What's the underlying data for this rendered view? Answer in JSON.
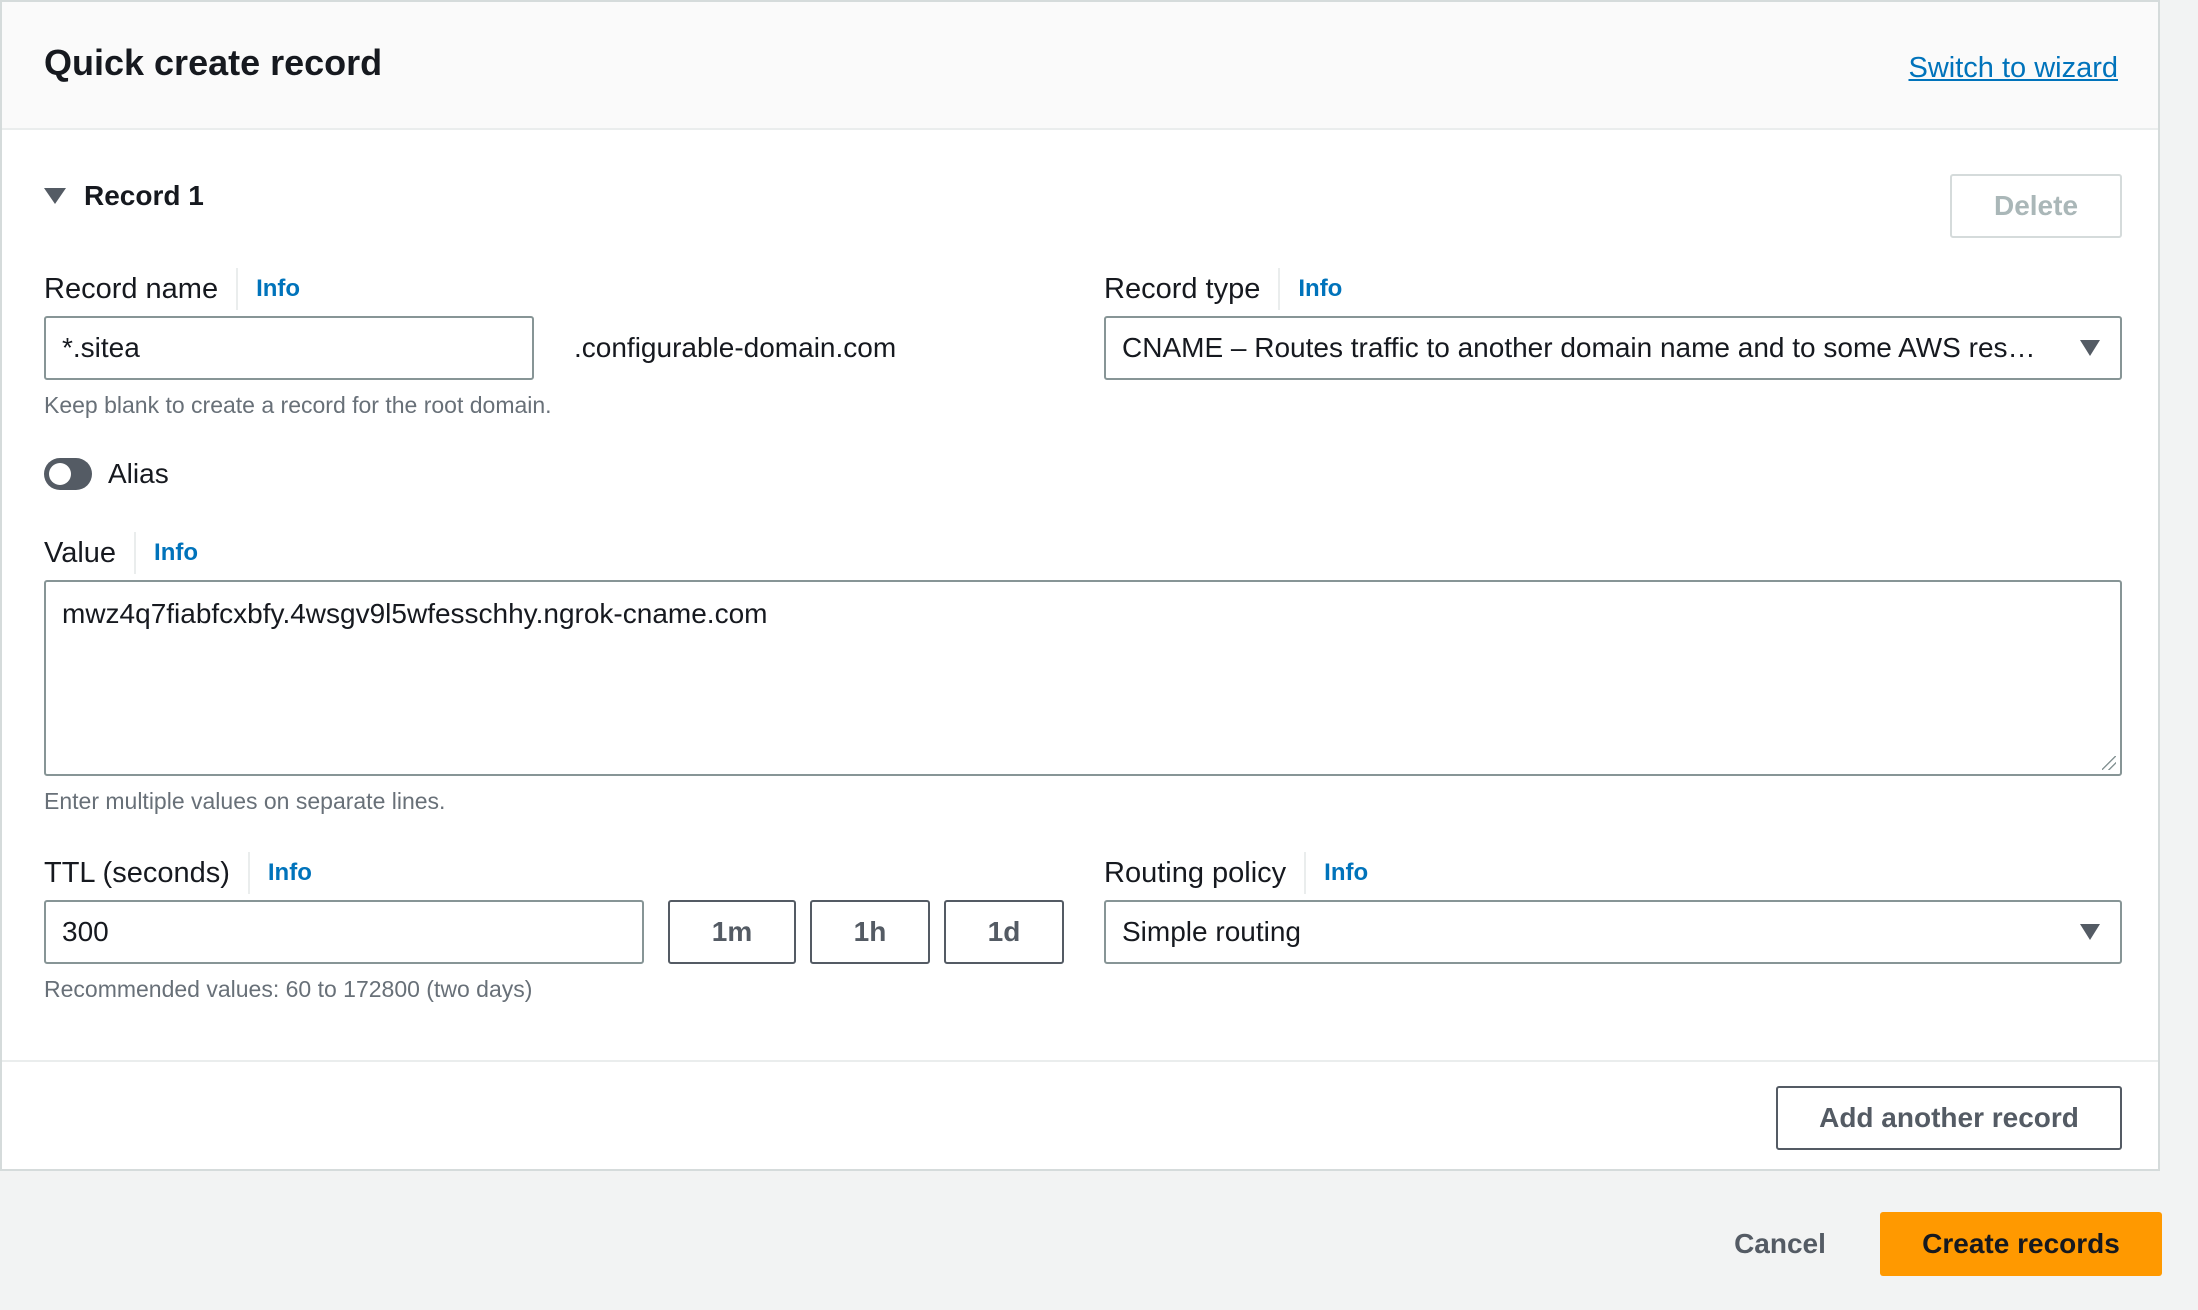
{
  "header": {
    "title": "Quick create record",
    "switch_link": "Switch to wizard"
  },
  "record": {
    "section_title": "Record 1",
    "delete_label": "Delete",
    "name": {
      "label": "Record name",
      "info": "Info",
      "value": "*.sitea",
      "domain_suffix": ".configurable-domain.com",
      "hint": "Keep blank to create a record for the root domain."
    },
    "type": {
      "label": "Record type",
      "info": "Info",
      "value": "CNAME – Routes traffic to another domain name and to some AWS resources"
    },
    "alias": {
      "label": "Alias",
      "enabled": false
    },
    "value": {
      "label": "Value",
      "info": "Info",
      "text": "mwz4q7fiabfcxbfy.4wsgv9l5wfesschhy.ngrok-cname.com",
      "hint": "Enter multiple values on separate lines."
    },
    "ttl": {
      "label": "TTL (seconds)",
      "info": "Info",
      "value": "300",
      "presets": [
        "1m",
        "1h",
        "1d"
      ],
      "hint": "Recommended values: 60 to 172800 (two days)"
    },
    "routing": {
      "label": "Routing policy",
      "info": "Info",
      "value": "Simple routing"
    }
  },
  "add_another_label": "Add another record",
  "footer": {
    "cancel_label": "Cancel",
    "create_label": "Create records"
  },
  "colors": {
    "link": "#0073bb",
    "primary_button": "#ff9900",
    "border": "#879596"
  }
}
